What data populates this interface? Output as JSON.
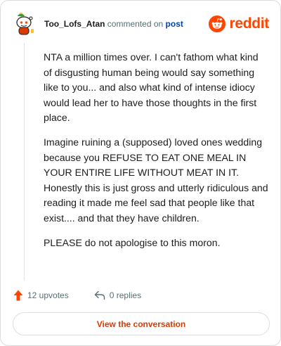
{
  "header": {
    "username": "Too_Lofs_Atan",
    "action": "commented on",
    "post_link": "post",
    "brand": "reddit"
  },
  "comment": {
    "paragraphs": [
      "NTA a million times over. I can't fathom what kind of disgusting human being would say something like to you... and also what kind of intense idiocy would lead her to have those thoughts in the first place.",
      "Imagine ruining a (supposed) loved ones wedding because you REFUSE TO EAT ONE MEAL IN YOUR ENTIRE LIFE WITHOUT MEAT IN IT. Honestly this is just gross and utterly ridiculous and reading it made me feel sad that people like that exist.... and that they have children.",
      "PLEASE do not apologise to this moron."
    ]
  },
  "footer": {
    "upvotes": "12 upvotes",
    "replies": "0 replies",
    "cta": "View the conversation"
  },
  "icons": {
    "avatar": "snoo-avatar-icon",
    "brand": "reddit-logo-icon",
    "upvote": "upvote-arrow-icon",
    "reply": "reply-arrow-icon"
  },
  "colors": {
    "brand": "#ff4500",
    "username": "#1c1c1c",
    "link": "#0045ac",
    "muted": "#576f76",
    "cta": "#d93a00"
  }
}
